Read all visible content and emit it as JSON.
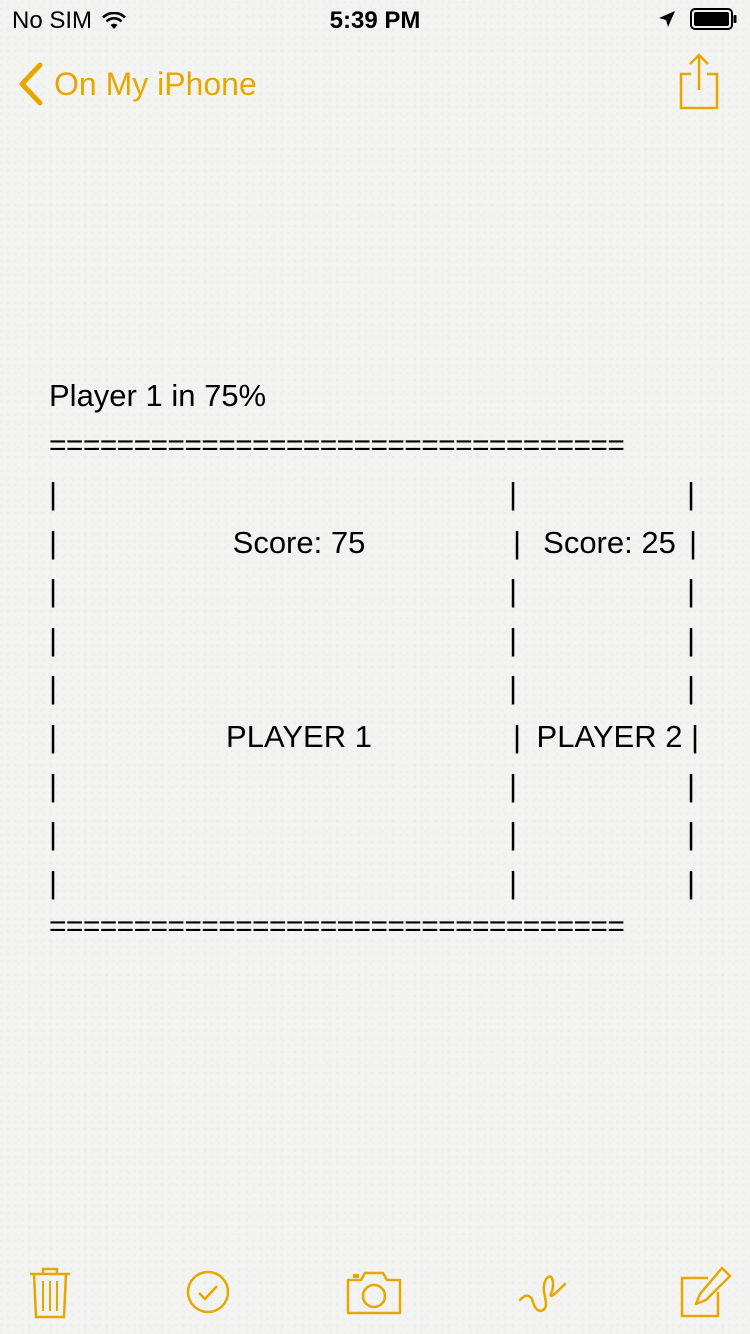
{
  "status_bar": {
    "carrier": "No SIM",
    "time": "5:39 PM",
    "icons": [
      "wifi-icon",
      "location-arrow-icon",
      "battery-icon"
    ]
  },
  "nav": {
    "back_label": "On My iPhone",
    "accent_color": "#E6A800",
    "icons": [
      "chevron-left-icon",
      "share-icon"
    ]
  },
  "note": {
    "title": "Player 1 in 75%",
    "rule": "==================================",
    "player1_score": "Score: 75",
    "player2_score": "Score: 25",
    "player1_label": "PLAYER 1",
    "player2_label": "PLAYER 2"
  },
  "toolbar": {
    "icons": [
      "trash-icon",
      "checklist-icon",
      "camera-icon",
      "sketch-icon",
      "compose-icon"
    ]
  }
}
